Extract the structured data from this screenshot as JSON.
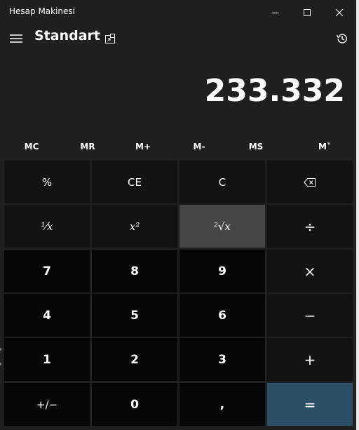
{
  "window": {
    "title": "Hesap Makinesi"
  },
  "header": {
    "mode": "Standart",
    "menu_icon": "hamburger-icon",
    "keep_on_top_icon": "keep-on-top-icon",
    "history_icon": "history-icon"
  },
  "display": {
    "value": "233.332"
  },
  "memory": {
    "mc": "MC",
    "mr": "MR",
    "mplus": "M+",
    "mminus": "M-",
    "ms": "MS",
    "mlist": "M˅"
  },
  "keys": {
    "percent": "%",
    "ce": "CE",
    "c": "C",
    "reciprocal": "¹⁄x",
    "square": "x²",
    "sqrt": "²√x",
    "divide": "÷",
    "seven": "7",
    "eight": "8",
    "nine": "9",
    "multiply": "×",
    "four": "4",
    "five": "5",
    "six": "6",
    "minus": "−",
    "one": "1",
    "two": "2",
    "three": "3",
    "plus": "+",
    "negate": "+/−",
    "zero": "0",
    "decimal": ",",
    "equals": "="
  },
  "colors": {
    "window_bg": "#1f1f1f",
    "function_key": "#131313",
    "number_key": "#060606",
    "hover_key": "#464646",
    "equals_key": "#2c4f68"
  }
}
